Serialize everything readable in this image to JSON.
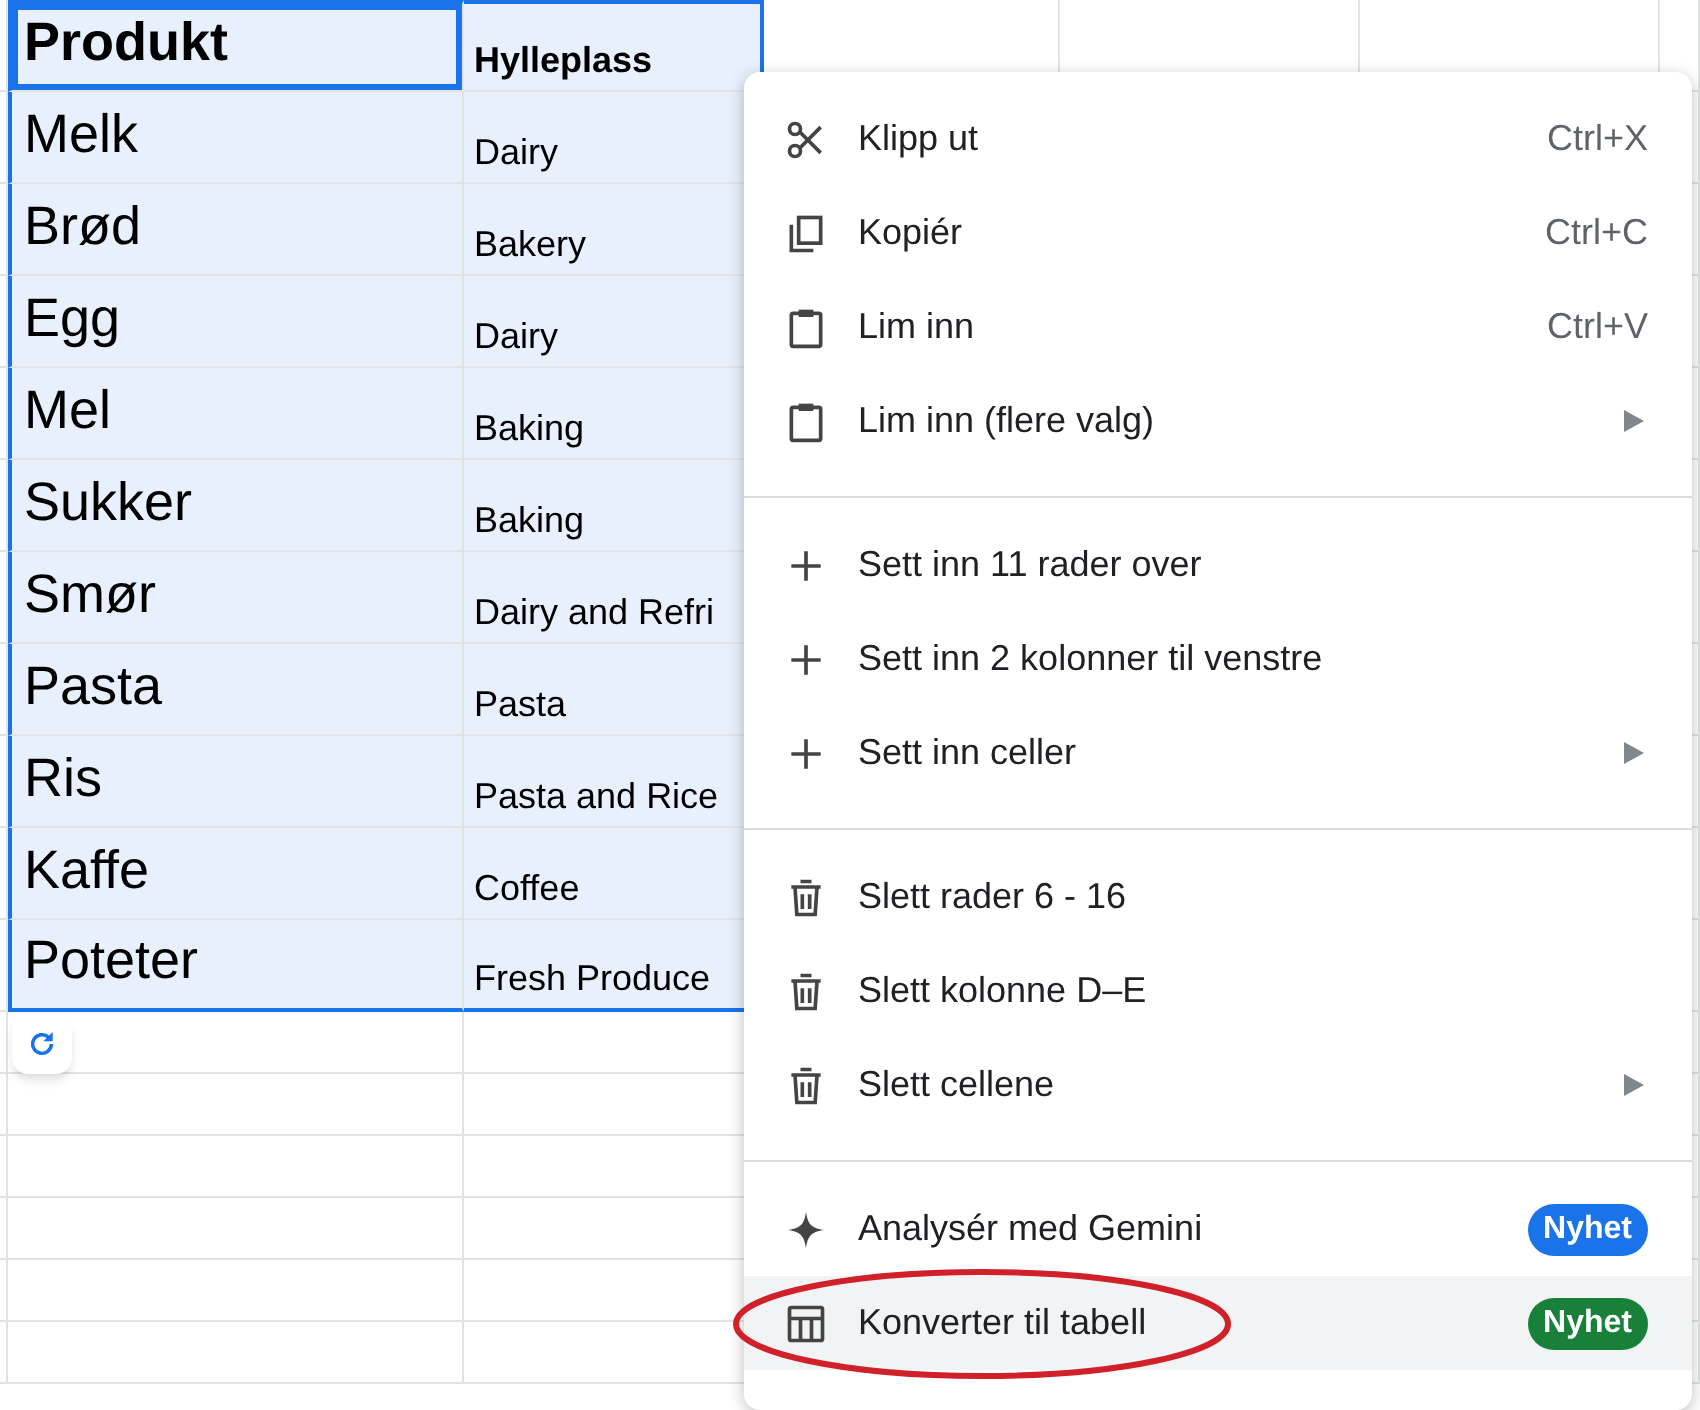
{
  "sheet": {
    "rows": [
      {
        "header": true,
        "selected": true,
        "cells": [
          {
            "text": "Produkt",
            "active": true
          },
          {
            "text": "Hylleplass",
            "active": false
          }
        ]
      },
      {
        "header": false,
        "selected": true,
        "cells": [
          {
            "text": "Melk",
            "active": false
          },
          {
            "text": "Dairy",
            "active": false
          }
        ]
      },
      {
        "header": false,
        "selected": true,
        "cells": [
          {
            "text": "Brød",
            "active": false
          },
          {
            "text": "Bakery",
            "active": false
          }
        ]
      },
      {
        "header": false,
        "selected": true,
        "cells": [
          {
            "text": "Egg",
            "active": false
          },
          {
            "text": "Dairy",
            "active": false
          }
        ]
      },
      {
        "header": false,
        "selected": true,
        "cells": [
          {
            "text": "Mel",
            "active": false
          },
          {
            "text": "Baking",
            "active": false
          }
        ]
      },
      {
        "header": false,
        "selected": true,
        "cells": [
          {
            "text": "Sukker",
            "active": false
          },
          {
            "text": "Baking",
            "active": false
          }
        ]
      },
      {
        "header": false,
        "selected": true,
        "cells": [
          {
            "text": "Smør",
            "active": false
          },
          {
            "text": "Dairy and Refri",
            "active": false
          }
        ]
      },
      {
        "header": false,
        "selected": true,
        "cells": [
          {
            "text": "Pasta",
            "active": false
          },
          {
            "text": "Pasta",
            "active": false
          }
        ]
      },
      {
        "header": false,
        "selected": true,
        "cells": [
          {
            "text": "Ris",
            "active": false
          },
          {
            "text": "Pasta and Rice",
            "active": false
          }
        ]
      },
      {
        "header": false,
        "selected": true,
        "cells": [
          {
            "text": "Kaffe",
            "active": false
          },
          {
            "text": "Coffee",
            "active": false
          }
        ]
      },
      {
        "header": false,
        "selected": true,
        "cells": [
          {
            "text": "Poteter",
            "active": false
          },
          {
            "text": "Fresh Produce",
            "active": false
          }
        ]
      }
    ]
  },
  "context_menu": {
    "sections": [
      [
        {
          "kind": "scissors",
          "label": "Klipp ut",
          "shortcut": "Ctrl+X",
          "submenu": false,
          "selected": false,
          "circled": false
        },
        {
          "kind": "copy",
          "label": "Kopiér",
          "shortcut": "Ctrl+C",
          "submenu": false,
          "selected": false,
          "circled": false
        },
        {
          "kind": "clipboard",
          "label": "Lim inn",
          "shortcut": "Ctrl+V",
          "submenu": false,
          "selected": false,
          "circled": false
        },
        {
          "kind": "clipboard",
          "label": "Lim inn (flere valg)",
          "submenu": true,
          "selected": false,
          "circled": false
        }
      ],
      [
        {
          "kind": "plus",
          "label": "Sett inn 11 rader over",
          "submenu": false,
          "selected": false,
          "circled": false
        },
        {
          "kind": "plus",
          "label": "Sett inn 2 kolonner til venstre",
          "submenu": false,
          "selected": false,
          "circled": false
        },
        {
          "kind": "plus",
          "label": "Sett inn celler",
          "submenu": true,
          "selected": false,
          "circled": false
        }
      ],
      [
        {
          "kind": "trash",
          "label": "Slett rader 6 - 16",
          "submenu": false,
          "selected": false,
          "circled": false
        },
        {
          "kind": "trash",
          "label": "Slett kolonne D–E",
          "submenu": false,
          "selected": false,
          "circled": false
        },
        {
          "kind": "trash",
          "label": "Slett cellene",
          "submenu": true,
          "selected": false,
          "circled": false
        }
      ],
      [
        {
          "kind": "sparkle",
          "label": "Analysér med Gemini",
          "badge": {
            "text": "Nyhet",
            "color": "#1a73e8"
          },
          "submenu": false,
          "selected": false,
          "circled": false
        },
        {
          "kind": "table",
          "label": "Konverter til tabell",
          "badge": {
            "text": "Nyhet",
            "color": "#188038"
          },
          "submenu": false,
          "selected": true,
          "circled": true
        }
      ]
    ]
  }
}
